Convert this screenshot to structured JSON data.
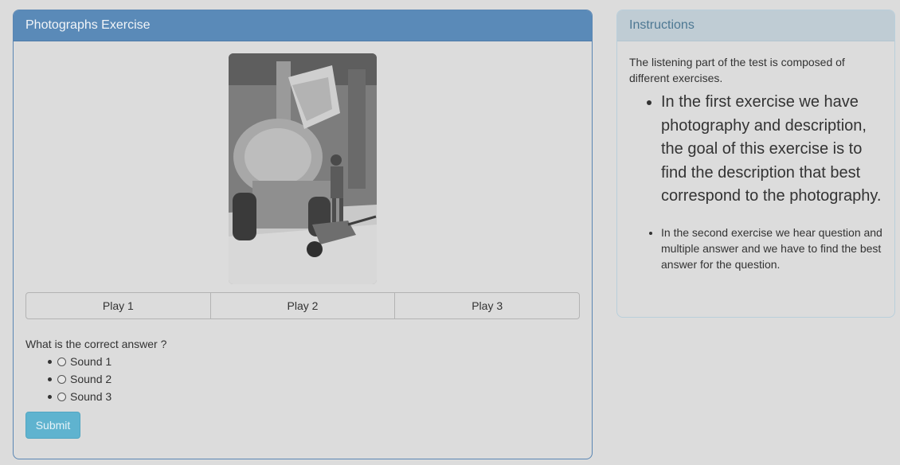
{
  "exercise_panel": {
    "title": "Photographs Exercise",
    "play_buttons": [
      "Play 1",
      "Play 2",
      "Play 3"
    ],
    "question": "What is the correct answer ?",
    "options": [
      "Sound 1",
      "Sound 2",
      "Sound 3"
    ],
    "submit_label": "Submit"
  },
  "instructions_panel": {
    "title": "Instructions",
    "intro": "The listening part of the test is composed of different exercises.",
    "bullets": [
      "In the first exercise we have photography and description, the goal of this exercise is to find the description that best correspond to the photography.",
      "In the second exercise we hear question and multiple answer and we have to find the best answer for the question."
    ]
  },
  "colors": {
    "primary_header": "#5a8ab8",
    "info_header": "#bfccd4",
    "submit_button": "#5fb3cf",
    "page_background": "#dcdcdc"
  }
}
